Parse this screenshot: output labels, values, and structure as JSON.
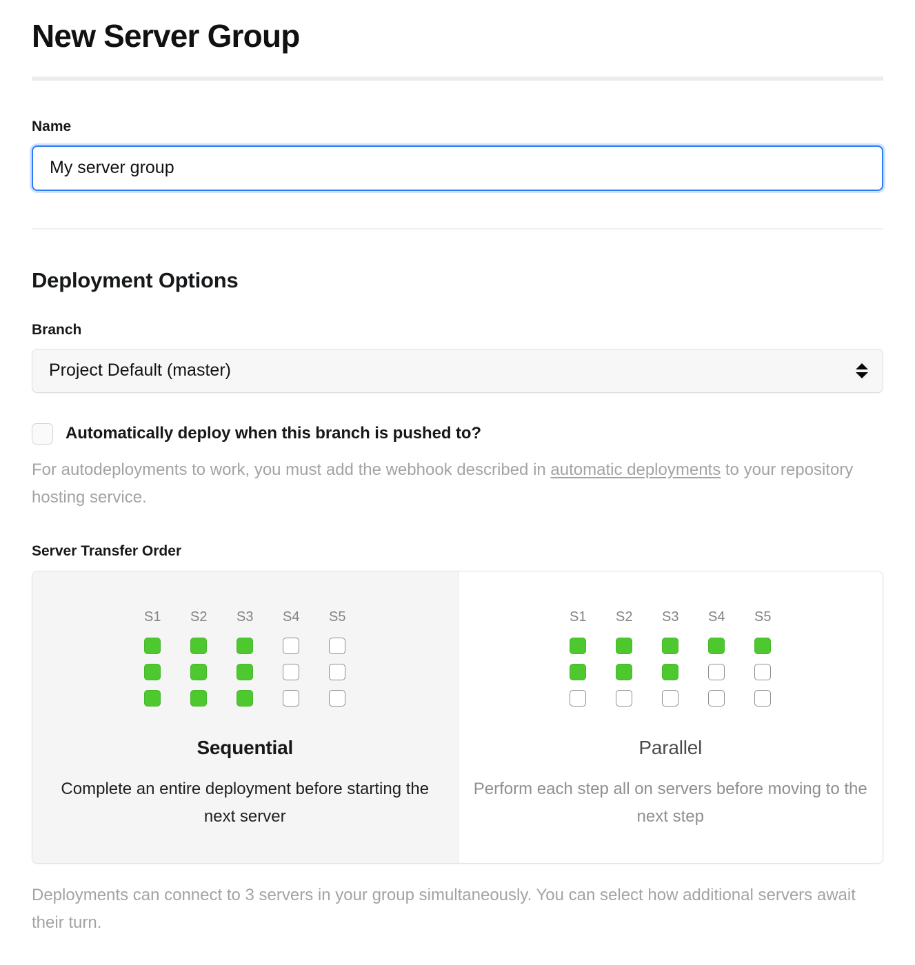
{
  "page": {
    "title": "New Server Group"
  },
  "name_field": {
    "label": "Name",
    "value": "My server group",
    "placeholder": "My server group"
  },
  "deployment": {
    "heading": "Deployment Options",
    "branch": {
      "label": "Branch",
      "selected": "Project Default (master)"
    },
    "autodeploy": {
      "label": "Automatically deploy when this branch is pushed to?",
      "checked": false,
      "help_before": "For autodeployments to work, you must add the webhook described in ",
      "help_link": "automatic deployments",
      "help_after": " to your repository hosting service."
    }
  },
  "transfer_order": {
    "label": "Server Transfer Order",
    "columns": [
      "S1",
      "S2",
      "S3",
      "S4",
      "S5"
    ],
    "options": [
      {
        "key": "sequential",
        "title": "Sequential",
        "description": "Complete an entire deployment before starting the next server",
        "selected": true,
        "grid": [
          [
            1,
            1,
            1,
            0,
            0
          ],
          [
            1,
            1,
            1,
            0,
            0
          ],
          [
            1,
            1,
            1,
            0,
            0
          ]
        ]
      },
      {
        "key": "parallel",
        "title": "Parallel",
        "description": "Perform each step all on servers before moving to the next step",
        "selected": false,
        "grid": [
          [
            1,
            1,
            1,
            1,
            1
          ],
          [
            1,
            1,
            1,
            0,
            0
          ],
          [
            0,
            0,
            0,
            0,
            0
          ]
        ]
      }
    ],
    "footnote": "Deployments can connect to 3 servers in your group simultaneously. You can select how additional servers await their turn."
  },
  "colors": {
    "cell_on": "#4dc82f",
    "cell_off_border": "#8d8d8d",
    "focus_border": "#2b7cf6",
    "muted_text": "#a3a3a3",
    "selected_card_bg": "#f5f5f5"
  },
  "icons": {
    "select_stepper": "chevron-up-down-icon",
    "checkbox": "checkbox-icon"
  }
}
